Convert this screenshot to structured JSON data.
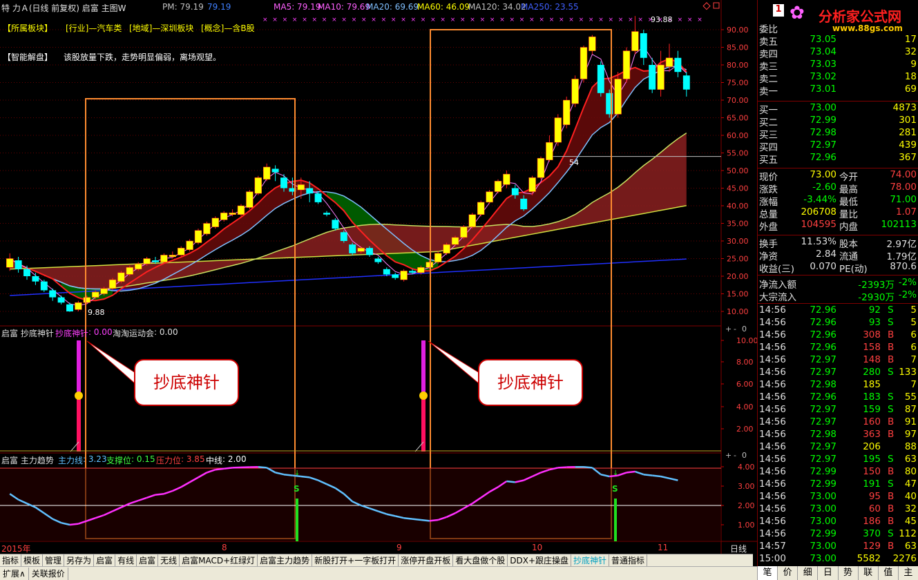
{
  "header": {
    "stock": "特 力Ａ(日线 前复权) 启富 主图W",
    "pm": "PM: 79.19",
    "pm2": "79.19",
    "ma5": "MA5: 79.19",
    "ma10": "MA10: 79.69",
    "ma20": "MA20: 69.69",
    "ma60": "MA60: 46.09",
    "ma120": "MA120: 34.02",
    "ma250": "MA250: 23.55"
  },
  "tags": {
    "t1": "【所属板块】",
    "t2": "[行业]—汽车类",
    "t3": "[地域]—深圳板块",
    "t4": "[概念]—含B股"
  },
  "analysis": {
    "label": "【智能解盘】",
    "text": "该股放量下跌，走势明显偏弱，离场观望。"
  },
  "logo": {
    "text": "分析家公式网",
    "url": "www.88gs.com",
    "badge": "1"
  },
  "main_yaxis": [
    "90.00",
    "85.00",
    "80.00",
    "75.00",
    "70.00",
    "65.00",
    "60.00",
    "55.00",
    "50.00",
    "45.00",
    "40.00",
    "35.00",
    "30.00",
    "25.00",
    "20.00",
    "15.00",
    "10.00"
  ],
  "high_label": "93.88",
  "low_label": "9.88",
  "mid_label": "54",
  "sub1": {
    "title": "启富 抄底神针",
    "name": "抄底神针",
    "v1": ": 0.00",
    "name2": "淘淘运动会",
    "v2": ": 0.00",
    "yaxis": [
      "10.00",
      "8.00",
      "6.00",
      "4.00",
      "2.00"
    ],
    "bubble": "抄底神针"
  },
  "sub2": {
    "title": "启富 主力趋势",
    "l1": "主力线",
    "v1": ": 3.23",
    "l2": "支撑位",
    "v2": ": 0.15",
    "l3": "压力位",
    "v3": ": 3.85",
    "l4": "中线",
    "v4": ": 2.00",
    "yaxis": [
      "4.00",
      "3.00",
      "2.00",
      "1.00"
    ],
    "s_mark": "S"
  },
  "xaxis": {
    "y2015": "2015年",
    "m8": "8",
    "m9": "9",
    "m10": "10",
    "m11": "11",
    "period": "日线"
  },
  "toolbar": [
    "指标",
    "模板",
    "管理",
    "另存为",
    "启富",
    "有线",
    "启富",
    "无线",
    "启富MACD+红绿灯",
    "启富主力趋势",
    "新股打开+一字板打开",
    "涨停开盘开板",
    "看大盘做个股",
    "DDX+跟庄操盘",
    "抄底神针",
    "普通指标"
  ],
  "toolbar2": [
    "扩展∧",
    "关联报价"
  ],
  "tabs": [
    "笔",
    "价",
    "细",
    "日",
    "势",
    "联",
    "值",
    "主"
  ],
  "order_book": {
    "weibi": "委比",
    "sells": [
      {
        "label": "卖五",
        "price": "73.05",
        "vol": "17"
      },
      {
        "label": "卖四",
        "price": "73.04",
        "vol": "32"
      },
      {
        "label": "卖三",
        "price": "73.03",
        "vol": "9"
      },
      {
        "label": "卖二",
        "price": "73.02",
        "vol": "18"
      },
      {
        "label": "卖一",
        "price": "73.01",
        "vol": "69"
      }
    ],
    "buys": [
      {
        "label": "买一",
        "price": "73.00",
        "vol": "4873"
      },
      {
        "label": "买二",
        "price": "72.99",
        "vol": "301"
      },
      {
        "label": "买三",
        "price": "72.98",
        "vol": "281"
      },
      {
        "label": "买四",
        "price": "72.97",
        "vol": "439"
      },
      {
        "label": "买五",
        "price": "72.96",
        "vol": "367"
      }
    ]
  },
  "quote": [
    {
      "l1": "现价",
      "v1": "73.00",
      "l2": "今开",
      "v2": "74.00",
      "c1": "y",
      "c2": "r"
    },
    {
      "l1": "涨跌",
      "v1": "-2.60",
      "l2": "最高",
      "v2": "78.00",
      "c1": "g",
      "c2": "r"
    },
    {
      "l1": "涨幅",
      "v1": "-3.44%",
      "l2": "最低",
      "v2": "71.00",
      "c1": "g",
      "c2": "g"
    },
    {
      "l1": "总量",
      "v1": "206708",
      "l2": "量比",
      "v2": "1.07",
      "c1": "y",
      "c2": "r"
    },
    {
      "l1": "外盘",
      "v1": "104595",
      "l2": "内盘",
      "v2": "102113",
      "c1": "r",
      "c2": "g"
    }
  ],
  "fund": [
    {
      "l1": "换手",
      "v1": "11.53%",
      "l2": "股本",
      "v2": "2.97亿"
    },
    {
      "l1": "净资",
      "v1": "2.84",
      "l2": "流通",
      "v2": "1.79亿"
    },
    {
      "l1": "收益(三)",
      "v1": "0.070",
      "l2": "PE(动)",
      "v2": "870.6"
    }
  ],
  "flow": [
    {
      "l": "净流入额",
      "v": "-2393万",
      "p": "-2%"
    },
    {
      "l": "大宗流入",
      "v": "-2930万",
      "p": "-2%"
    }
  ],
  "ticks": [
    {
      "t": "14:56",
      "p": "72.96",
      "v": "92",
      "s": "S",
      "n": "5"
    },
    {
      "t": "14:56",
      "p": "72.96",
      "v": "93",
      "s": "S",
      "n": "5"
    },
    {
      "t": "14:56",
      "p": "72.96",
      "v": "308",
      "s": "B",
      "n": "6"
    },
    {
      "t": "14:56",
      "p": "72.96",
      "v": "158",
      "s": "B",
      "n": "6"
    },
    {
      "t": "14:56",
      "p": "72.97",
      "v": "148",
      "s": "B",
      "n": "7"
    },
    {
      "t": "14:56",
      "p": "72.97",
      "v": "280",
      "s": "S",
      "n": "133"
    },
    {
      "t": "14:56",
      "p": "72.98",
      "v": "185",
      "s": "",
      "n": "7"
    },
    {
      "t": "14:56",
      "p": "72.96",
      "v": "183",
      "s": "S",
      "n": "55"
    },
    {
      "t": "14:56",
      "p": "72.97",
      "v": "159",
      "s": "S",
      "n": "87"
    },
    {
      "t": "14:56",
      "p": "72.97",
      "v": "160",
      "s": "B",
      "n": "91"
    },
    {
      "t": "14:56",
      "p": "72.98",
      "v": "363",
      "s": "B",
      "n": "97"
    },
    {
      "t": "14:56",
      "p": "72.97",
      "v": "206",
      "s": "",
      "n": "88"
    },
    {
      "t": "14:56",
      "p": "72.97",
      "v": "195",
      "s": "S",
      "n": "63"
    },
    {
      "t": "14:56",
      "p": "72.99",
      "v": "150",
      "s": "B",
      "n": "80"
    },
    {
      "t": "14:56",
      "p": "72.99",
      "v": "191",
      "s": "S",
      "n": "47"
    },
    {
      "t": "14:56",
      "p": "73.00",
      "v": "95",
      "s": "B",
      "n": "40"
    },
    {
      "t": "14:56",
      "p": "73.00",
      "v": "60",
      "s": "B",
      "n": "32"
    },
    {
      "t": "14:56",
      "p": "73.00",
      "v": "186",
      "s": "B",
      "n": "45"
    },
    {
      "t": "14:56",
      "p": "72.99",
      "v": "370",
      "s": "S",
      "n": "112"
    },
    {
      "t": "14:57",
      "p": "73.00",
      "v": "129",
      "s": "B",
      "n": "63"
    },
    {
      "t": "15:00",
      "p": "73.00",
      "v": "5582",
      "s": "",
      "n": "2276"
    }
  ],
  "colors": {
    "up": "#ffff00",
    "down": "#00ffff",
    "up_red": "#ff2020",
    "frame": "#ff8c30",
    "green_band": "#007000",
    "red_band": "#7a1010"
  },
  "chart_data": {
    "type": "candlestick",
    "price_range": [
      10,
      92
    ],
    "candles": [
      [
        22.5,
        25.0,
        26.5,
        21.5
      ],
      [
        24.5,
        22.0,
        25.5,
        21.0
      ],
      [
        22.0,
        20.0,
        23.0,
        19.0
      ],
      [
        20.0,
        18.5,
        21.0,
        17.5
      ],
      [
        18.5,
        16.0,
        19.0,
        15.5
      ],
      [
        16.0,
        14.0,
        16.5,
        13.0
      ],
      [
        14.0,
        12.5,
        14.5,
        12.0
      ],
      [
        12.0,
        10.0,
        12.5,
        9.88
      ],
      [
        10.5,
        12.5,
        13.0,
        10.0
      ],
      [
        12.5,
        14.0,
        14.5,
        12.0
      ],
      [
        14.0,
        15.5,
        16.0,
        13.5
      ],
      [
        15.0,
        16.5,
        17.0,
        14.5
      ],
      [
        16.5,
        19.0,
        19.5,
        16.0
      ],
      [
        18.5,
        21.0,
        21.5,
        18.0
      ],
      [
        20.5,
        22.5,
        23.0,
        20.0
      ],
      [
        22.0,
        23.5,
        24.0,
        21.5
      ],
      [
        23.5,
        25.0,
        25.5,
        23.0
      ],
      [
        24.5,
        24.0,
        25.5,
        23.5
      ],
      [
        24.0,
        26.0,
        26.5,
        23.5
      ],
      [
        25.5,
        26.0,
        27.0,
        25.0
      ],
      [
        26.0,
        28.0,
        28.5,
        25.5
      ],
      [
        27.5,
        30.0,
        30.5,
        27.0
      ],
      [
        29.5,
        33.0,
        33.5,
        29.0
      ],
      [
        32.0,
        35.0,
        35.5,
        31.5
      ],
      [
        34.0,
        36.5,
        37.0,
        33.5
      ],
      [
        36.0,
        38.0,
        38.5,
        35.5
      ],
      [
        37.5,
        38.0,
        39.0,
        37.0
      ],
      [
        37.5,
        40.0,
        40.5,
        37.0
      ],
      [
        39.5,
        44.0,
        44.5,
        39.0
      ],
      [
        43.5,
        48.0,
        48.5,
        43.0
      ],
      [
        47.5,
        51.0,
        52.0,
        47.0
      ],
      [
        50.5,
        49.5,
        51.5,
        47.0
      ],
      [
        48.0,
        45.0,
        49.0,
        44.0
      ],
      [
        45.0,
        44.0,
        48.0,
        43.0
      ],
      [
        44.5,
        46.0,
        48.0,
        42.0
      ],
      [
        45.0,
        43.5,
        47.0,
        41.0
      ],
      [
        43.5,
        41.0,
        44.0,
        40.5
      ],
      [
        38.0,
        37.5,
        38.5,
        37.0
      ],
      [
        36.0,
        33.5,
        36.5,
        33.0
      ],
      [
        32.5,
        30.0,
        33.0,
        29.5
      ],
      [
        29.0,
        26.5,
        29.5,
        26.0
      ],
      [
        27.0,
        28.0,
        28.5,
        26.5
      ],
      [
        28.0,
        26.0,
        28.5,
        25.5
      ],
      [
        25.0,
        24.0,
        25.5,
        23.5
      ],
      [
        22.0,
        20.5,
        22.5,
        20.0
      ],
      [
        20.5,
        19.5,
        21.0,
        19.0
      ],
      [
        19.0,
        21.5,
        22.0,
        18.5
      ],
      [
        21.5,
        21.0,
        22.0,
        20.5
      ],
      [
        21.0,
        22.5,
        23.0,
        20.5
      ],
      [
        22.5,
        24.0,
        24.5,
        22.0
      ],
      [
        24.0,
        26.5,
        27.0,
        23.5
      ],
      [
        26.5,
        29.0,
        29.5,
        26.0
      ],
      [
        29.0,
        31.0,
        31.5,
        28.5
      ],
      [
        31.0,
        34.0,
        34.5,
        30.5
      ],
      [
        34.0,
        37.5,
        38.0,
        33.5
      ],
      [
        37.5,
        41.0,
        41.5,
        37.0
      ],
      [
        41.0,
        44.0,
        44.5,
        40.5
      ],
      [
        44.0,
        47.0,
        47.5,
        43.5
      ],
      [
        46.0,
        49.0,
        50.0,
        45.0
      ],
      [
        45.0,
        43.0,
        46.0,
        42.0
      ],
      [
        42.0,
        39.0,
        43.0,
        38.5
      ],
      [
        44.0,
        48.0,
        48.5,
        43.0
      ],
      [
        48.0,
        53.5,
        54.0,
        47.5
      ],
      [
        53.0,
        58.0,
        60.0,
        52.5
      ],
      [
        58.0,
        65.0,
        66.0,
        57.0
      ],
      [
        63.0,
        70.0,
        71.0,
        62.0
      ],
      [
        69.0,
        76.0,
        77.0,
        68.0
      ],
      [
        76.0,
        85.0,
        85.5,
        75.0
      ],
      [
        84.0,
        88.0,
        88.5,
        83.0
      ],
      [
        80.0,
        72.0,
        81.0,
        71.0
      ],
      [
        72.0,
        66.0,
        73.0,
        65.0
      ],
      [
        66.0,
        76.0,
        78.0,
        65.0
      ],
      [
        76.0,
        84.0,
        85.0,
        75.0
      ],
      [
        84.0,
        89.5,
        93.88,
        83.0
      ],
      [
        89.0,
        82.0,
        90.0,
        80.0
      ],
      [
        80.0,
        73.0,
        82.0,
        72.0
      ],
      [
        73.0,
        80.0,
        84.0,
        71.0
      ],
      [
        79.5,
        82.0,
        86.0,
        78.0
      ],
      [
        82.0,
        78.0,
        84.0,
        76.5
      ],
      [
        77.0,
        73.0,
        78.0,
        71.0
      ]
    ]
  }
}
